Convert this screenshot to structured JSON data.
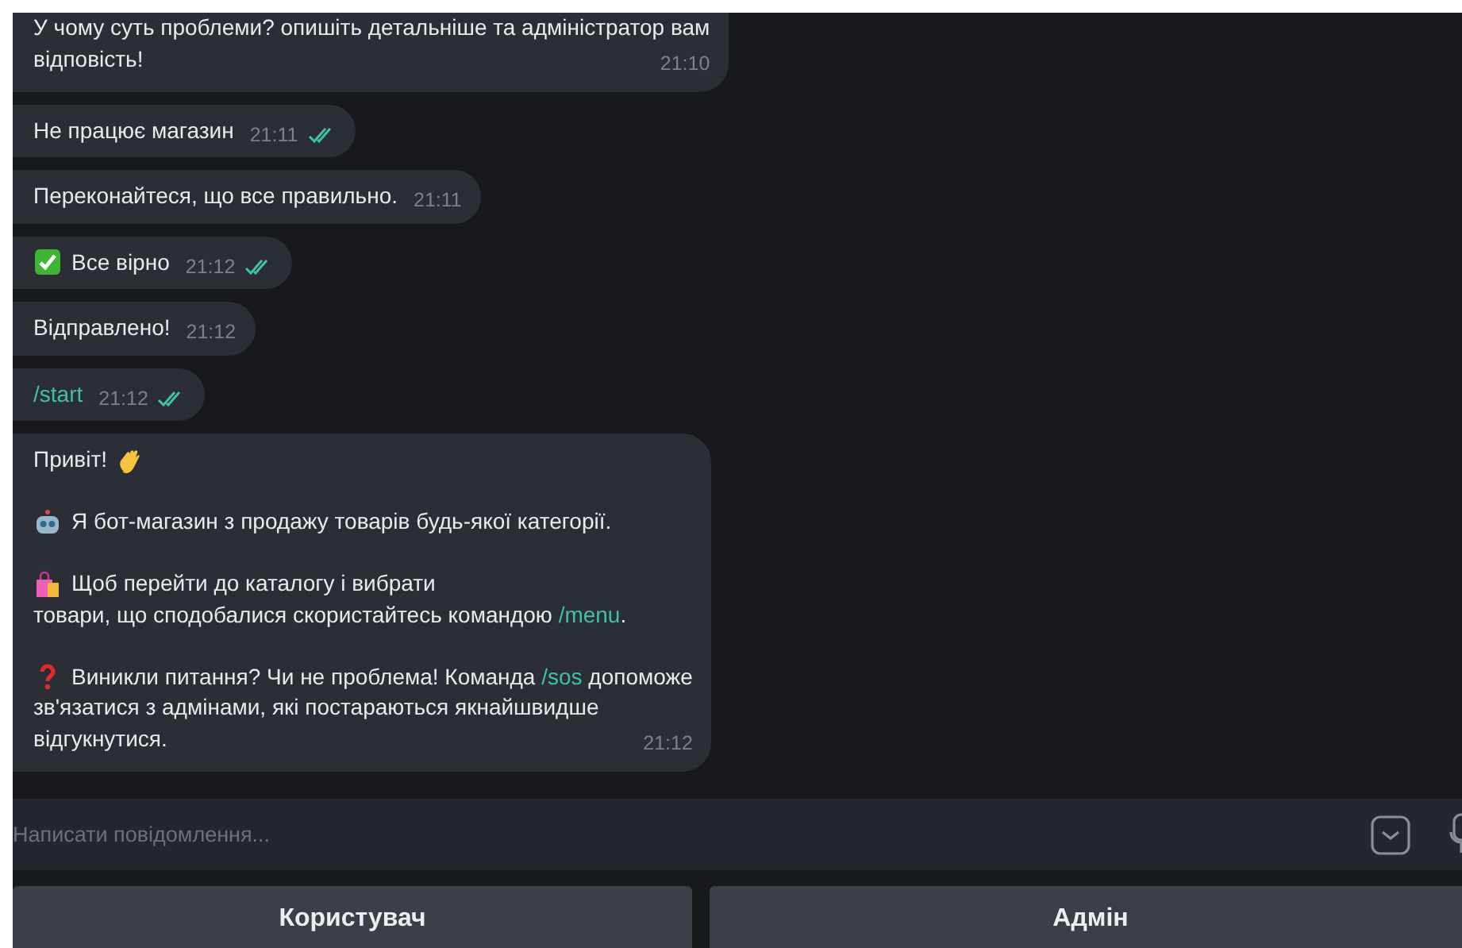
{
  "chat": {
    "messages": [
      {
        "outgoing": false,
        "time": "21:10",
        "paragraphs": [
          {
            "lines": [
              [
                {
                  "kind": "plain",
                  "text": "У чому суть проблеми? опишіть детальніше та адміністратор вам"
                }
              ],
              [
                {
                  "kind": "plain",
                  "text": "відповість!"
                }
              ]
            ]
          }
        ]
      },
      {
        "outgoing": true,
        "read": true,
        "time": "21:11",
        "paragraphs": [
          {
            "lines": [
              [
                {
                  "kind": "plain",
                  "text": "Не працює магазин"
                }
              ]
            ]
          }
        ]
      },
      {
        "outgoing": false,
        "time": "21:11",
        "paragraphs": [
          {
            "lines": [
              [
                {
                  "kind": "plain",
                  "text": "Переконайтеся, що все правильно."
                }
              ]
            ]
          }
        ]
      },
      {
        "outgoing": true,
        "read": true,
        "time": "21:12",
        "paragraphs": [
          {
            "lines": [
              [
                {
                  "kind": "check_emoji"
                },
                {
                  "kind": "plain",
                  "text": "Все вірно"
                }
              ]
            ]
          }
        ]
      },
      {
        "outgoing": false,
        "time": "21:12",
        "paragraphs": [
          {
            "lines": [
              [
                {
                  "kind": "plain",
                  "text": "Відправлено!"
                }
              ]
            ]
          }
        ]
      },
      {
        "outgoing": true,
        "read": true,
        "time": "21:12",
        "paragraphs": [
          {
            "lines": [
              [
                {
                  "kind": "command",
                  "text": "/start"
                }
              ]
            ]
          }
        ]
      },
      {
        "outgoing": false,
        "time": "21:12",
        "paragraphs": [
          {
            "lines": [
              [
                {
                  "kind": "plain",
                  "text": "Привіт!"
                },
                {
                  "kind": "wave_emoji"
                }
              ]
            ]
          },
          {
            "lines": [
              [
                {
                  "kind": "robot_emoji"
                },
                {
                  "kind": "plain",
                  "text": "Я бот-магазин з продажу товарів будь-якої категорії."
                }
              ]
            ]
          },
          {
            "lines": [
              [
                {
                  "kind": "bags_emoji"
                },
                {
                  "kind": "plain",
                  "text": "Щоб перейти до каталогу і вибрати"
                }
              ],
              [
                {
                  "kind": "plain",
                  "text": "товари, що сподобалися скористайтесь командою "
                },
                {
                  "kind": "command",
                  "text": "/menu"
                },
                {
                  "kind": "plain",
                  "text": "."
                }
              ]
            ]
          },
          {
            "lines": [
              [
                {
                  "kind": "question_emoji"
                },
                {
                  "kind": "plain",
                  "text": "Виникли питання? Чи не проблема! Команда "
                },
                {
                  "kind": "command",
                  "text": "/sos"
                },
                {
                  "kind": "plain",
                  "text": " допоможе"
                }
              ],
              [
                {
                  "kind": "plain",
                  "text": "зв'язатися з адмінами, які постараються якнайшвидше"
                }
              ],
              [
                {
                  "kind": "plain",
                  "text": "відгукнутися."
                }
              ]
            ]
          }
        ]
      }
    ]
  },
  "composer": {
    "placeholder": "Написати повідомлення..."
  },
  "keyboard": [
    {
      "label": "Користувач"
    },
    {
      "label": "Адмін"
    }
  ]
}
